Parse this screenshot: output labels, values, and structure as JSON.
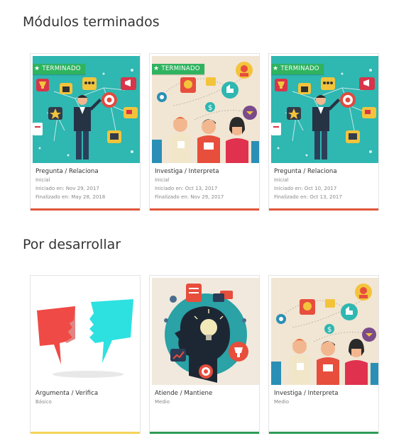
{
  "sections": {
    "completed_title": "Módulos terminados",
    "pending_title": "Por desarrollar"
  },
  "badge_label": "TERMINADO",
  "completed": [
    {
      "title": "Pregunta / Relaciona",
      "level": "Inicial",
      "started": "Iniciado en: Nov 29, 2017",
      "finished": "Finalizado en: May 28, 2018",
      "image": "social-network-illustration",
      "bar_color": "#e0553a"
    },
    {
      "title": "Investiga / Interpreta",
      "level": "Inicial",
      "started": "Iniciado en: Oct 13, 2017",
      "finished": "Finalizado en: Nov 29, 2017",
      "image": "people-chat-illustration",
      "bar_color": "#e0553a"
    },
    {
      "title": "Pregunta / Relaciona",
      "level": "Inicial",
      "started": "Iniciado en: Oct 10, 2017",
      "finished": "Finalizado en: Oct 13, 2017",
      "image": "social-network-illustration",
      "bar_color": "#e0553a"
    }
  ],
  "pending": [
    {
      "title": "Argumenta / Verifica",
      "level": "Básico",
      "image": "speech-bubbles-illustration",
      "bar_color": "#f5d35a"
    },
    {
      "title": "Atiende / Mantiene",
      "level": "Medio",
      "image": "head-ideas-illustration",
      "bar_color": "#2e9c57"
    },
    {
      "title": "Investiga / Interpreta",
      "level": "Medio",
      "image": "people-chat-illustration",
      "bar_color": "#2e9c57"
    }
  ]
}
